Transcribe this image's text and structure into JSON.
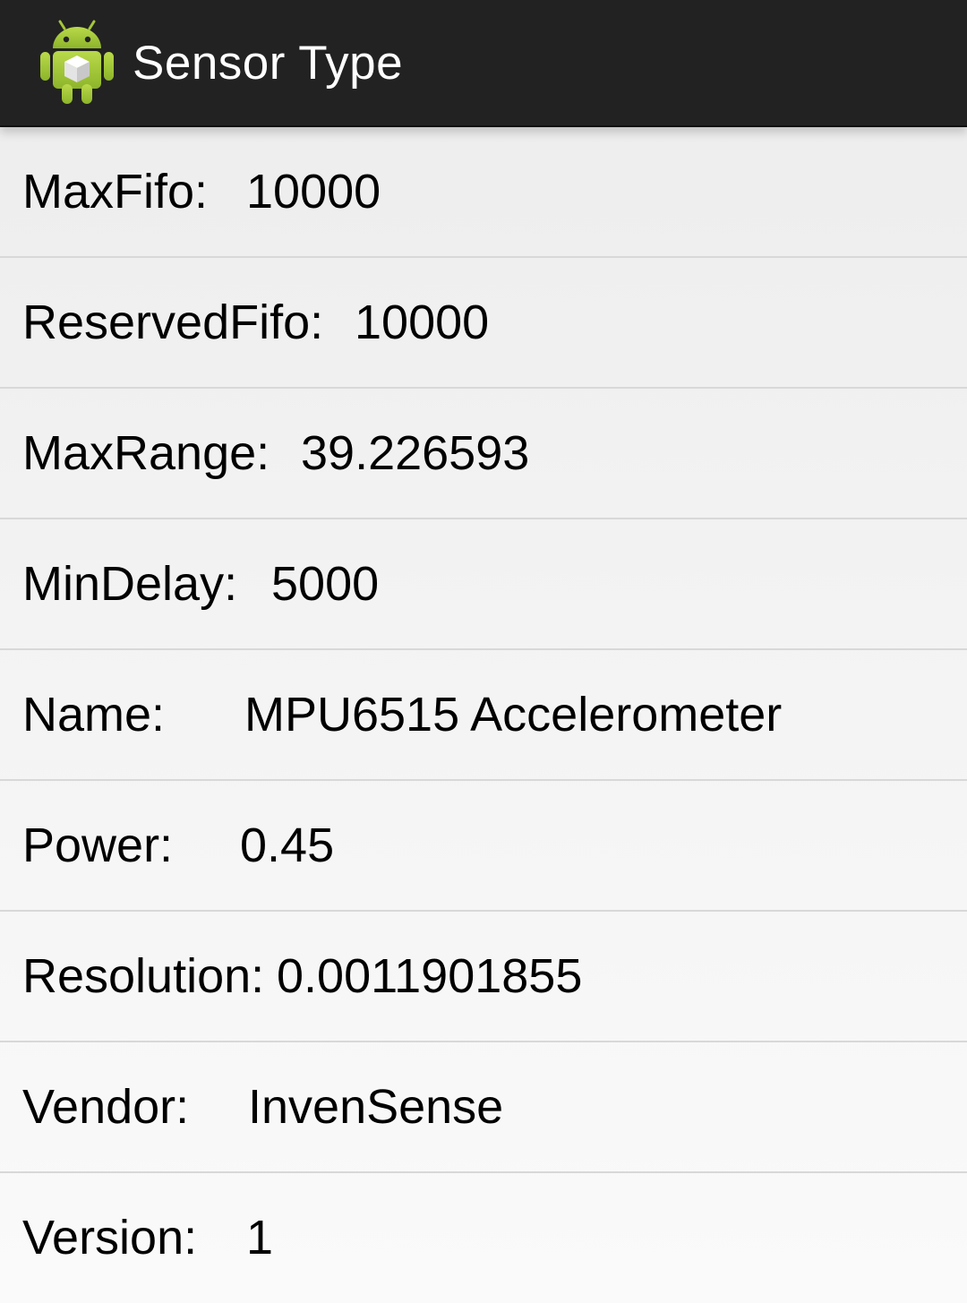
{
  "app_bar": {
    "title": "Sensor Type",
    "icon": "android-robot-icon",
    "colors": {
      "background": "#222222",
      "title": "#ffffff",
      "android_green": "#a4c639"
    }
  },
  "properties": [
    {
      "label": "MaxFifo:",
      "value": "10000"
    },
    {
      "label": "ReservedFifo:",
      "value": "10000"
    },
    {
      "label": "MaxRange:",
      "value": "39.226593"
    },
    {
      "label": "MinDelay:",
      "value": "5000"
    },
    {
      "label": "Name:",
      "value": "MPU6515 Accelerometer"
    },
    {
      "label": "Power:",
      "value": "0.45"
    },
    {
      "label": "Resolution:",
      "value": "0.0011901855"
    },
    {
      "label": "Vendor:",
      "value": "InvenSense"
    },
    {
      "label": "Version:",
      "value": "1"
    }
  ]
}
